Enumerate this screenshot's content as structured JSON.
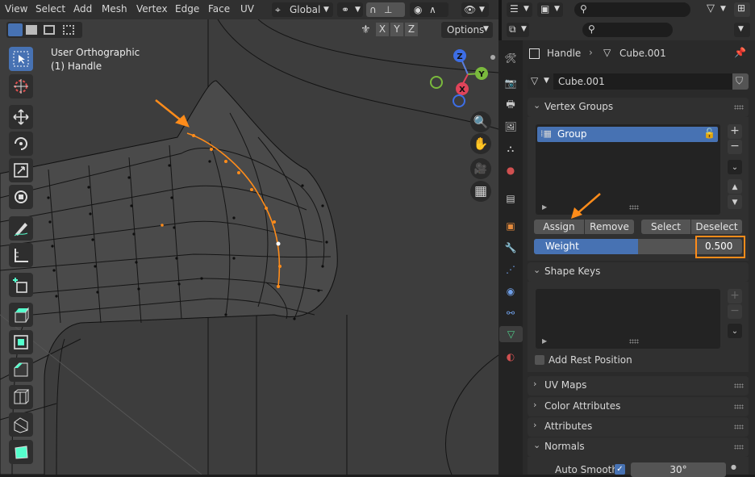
{
  "viewport": {
    "menu": [
      "View",
      "Select",
      "Add",
      "Mesh",
      "Vertex",
      "Edge",
      "Face",
      "UV"
    ],
    "orientation": "Global",
    "axes": [
      "X",
      "Y",
      "Z"
    ],
    "options_label": "Options",
    "view_name": "User Orthographic",
    "object_name": "(1) Handle",
    "gizmo_axes": [
      "Z",
      "Y",
      "X"
    ]
  },
  "properties": {
    "breadcrumb": {
      "object": "Handle",
      "mesh": "Cube.001"
    },
    "data_name": "Cube.001",
    "vertex_groups": {
      "title": "Vertex Groups",
      "items": [
        {
          "name": "Group"
        }
      ],
      "buttons": {
        "assign": "Assign",
        "remove": "Remove",
        "select": "Select",
        "deselect": "Deselect"
      },
      "weight_label": "Weight",
      "weight_value": "0.500",
      "weight_fraction": 0.5
    },
    "shape_keys": {
      "title": "Shape Keys",
      "add_rest_position": "Add Rest Position"
    },
    "panels": [
      "UV Maps",
      "Color Attributes",
      "Attributes",
      "Normals"
    ],
    "normals": {
      "auto_smooth_label": "Auto Smooth",
      "angle": "30°",
      "auto_smooth_checked": true
    }
  },
  "colors": {
    "accent_blue": "#4772b3",
    "highlight_orange": "#ff8c1a",
    "viewport_bg": "#3d3d3d",
    "panel_bg": "#2a2a2a"
  }
}
